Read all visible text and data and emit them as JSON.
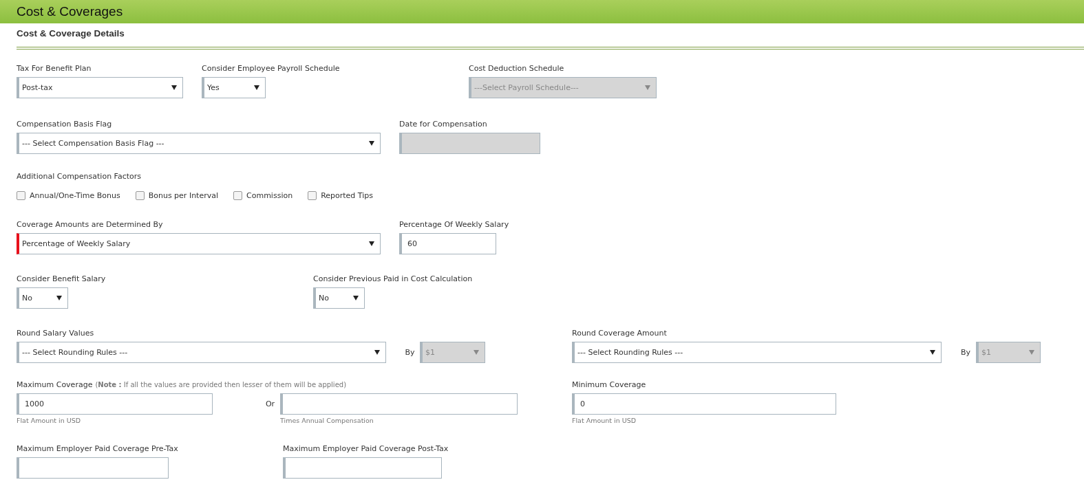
{
  "header": {
    "title": "Cost & Coverages"
  },
  "section": {
    "title": "Cost & Coverage Details"
  },
  "rows": [
    {
      "items": [
        {
          "kind": "select",
          "label": "Tax For Benefit Plan",
          "value": "Post-tax",
          "disabled": false,
          "required": false
        },
        {
          "kind": "select",
          "label": "Consider Employee Payroll Schedule",
          "value": "Yes",
          "disabled": false,
          "required": false
        },
        {
          "kind": "select",
          "label": "Cost Deduction Schedule",
          "value": "---Select Payroll Schedule---",
          "disabled": true,
          "required": false
        }
      ]
    },
    {
      "items": [
        {
          "kind": "select",
          "label": "Compensation Basis Flag",
          "value": "--- Select Compensation Basis Flag ---",
          "disabled": false,
          "required": false
        },
        {
          "kind": "input",
          "label": "Date for Compensation",
          "disabled": true,
          "required": false
        }
      ]
    },
    {
      "label": "Additional Compensation Factors",
      "items": [
        {
          "kind": "checkbox",
          "label": "Annual/One-Time Bonus",
          "checked": false
        },
        {
          "kind": "checkbox",
          "label": "Bonus per Interval",
          "checked": false
        },
        {
          "kind": "checkbox",
          "label": "Commission",
          "checked": false
        },
        {
          "kind": "checkbox",
          "label": "Reported Tips",
          "checked": false
        }
      ]
    },
    {
      "items": [
        {
          "kind": "select",
          "label": "Coverage Amounts are Determined By",
          "value": "Percentage of Weekly Salary",
          "disabled": false,
          "required": true
        },
        {
          "kind": "input",
          "label": "Percentage Of Weekly Salary",
          "value": "60",
          "disabled": false,
          "required": false
        }
      ]
    },
    {
      "items": [
        {
          "kind": "select",
          "label": "Consider Benefit Salary",
          "value": "No",
          "disabled": false,
          "required": false
        },
        {
          "kind": "select",
          "label": "Consider Previous Paid in Cost Calculation",
          "value": "No",
          "disabled": false,
          "required": false
        }
      ]
    },
    {
      "items": [
        {
          "kind": "select",
          "label": "Round Salary Values",
          "value": "--- Select Rounding Rules ---",
          "disabled": false,
          "required": false
        },
        {
          "kind": "joiner",
          "text": "By"
        },
        {
          "kind": "select",
          "value": "$1",
          "disabled": true,
          "required": false
        },
        {
          "kind": "select",
          "label": "Round Coverage Amount",
          "value": "--- Select Rounding Rules ---",
          "disabled": false,
          "required": false
        },
        {
          "kind": "joiner",
          "text": "By"
        },
        {
          "kind": "select",
          "value": "$1",
          "disabled": true,
          "required": false
        }
      ]
    },
    {
      "items": [
        {
          "kind": "input",
          "label": "Maximum Coverage",
          "note": "(**Note :** If all the values are provided then lesser of them will be applied)",
          "value": "1000",
          "hint": "Flat Amount in USD",
          "disabled": false,
          "required": false
        },
        {
          "kind": "joiner",
          "text": "Or"
        },
        {
          "kind": "input",
          "hint": "Times Annual Compensation",
          "disabled": false,
          "required": false
        },
        {
          "kind": "input",
          "label": "Minimum Coverage",
          "value": "0",
          "hint": "Flat Amount in USD",
          "disabled": false,
          "required": false
        }
      ]
    },
    {
      "items": [
        {
          "kind": "input",
          "label": "Maximum Employer Paid Coverage Pre-Tax",
          "disabled": false,
          "required": false
        },
        {
          "kind": "input",
          "label": "Maximum Employer Paid Coverage Post-Tax",
          "disabled": false,
          "required": false
        }
      ]
    }
  ]
}
